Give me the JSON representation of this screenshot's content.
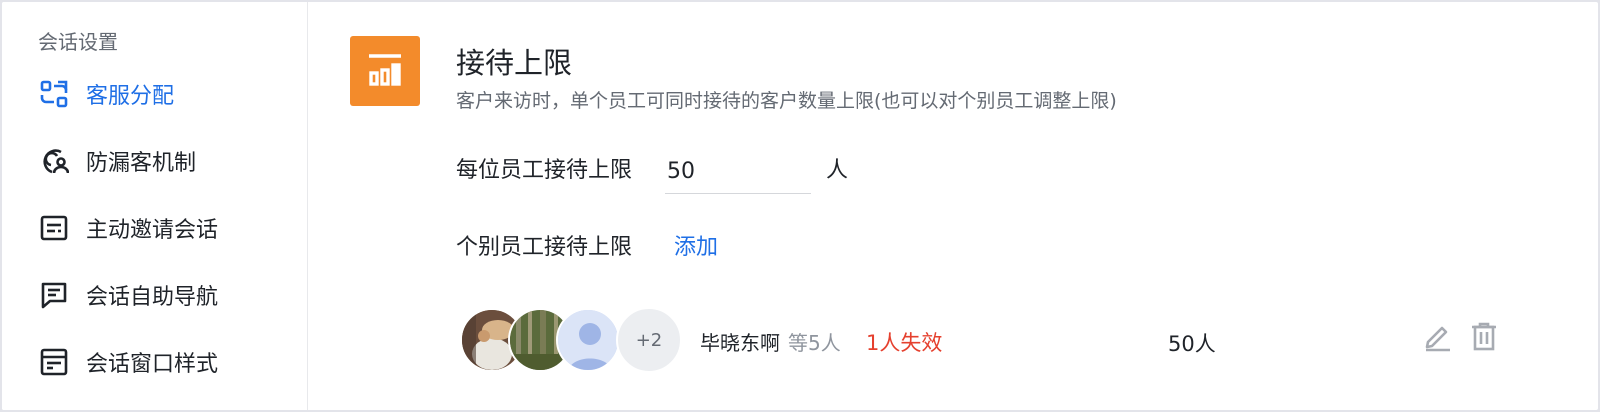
{
  "sidebar": {
    "title": "会话设置",
    "items": [
      {
        "label": "客服分配",
        "icon": "assign-icon",
        "active": true
      },
      {
        "label": "防漏客机制",
        "icon": "anti-leak-icon",
        "active": false
      },
      {
        "label": "主动邀请会话",
        "icon": "invite-icon",
        "active": false
      },
      {
        "label": "会话自助导航",
        "icon": "navigation-icon",
        "active": false
      },
      {
        "label": "会话窗口样式",
        "icon": "window-style-icon",
        "active": false
      }
    ]
  },
  "main": {
    "feature_icon": "bar-chart-icon",
    "title": "接待上限",
    "description": "客户来访时，单个员工可同时接待的客户数量上限(也可以对个别员工调整上限)",
    "per_staff": {
      "label": "每位员工接待上限",
      "value": "50",
      "unit": "人"
    },
    "individual": {
      "label": "个别员工接待上限",
      "add_label": "添加"
    },
    "staff_row": {
      "more_badge": "+2",
      "name": "毕晓东啊",
      "count_text": "等5人",
      "invalid_text": "1人失效",
      "limit": "50人",
      "edit_icon": "edit-icon",
      "delete_icon": "trash-icon"
    }
  },
  "colors": {
    "accent": "#1f6fe6",
    "feature_icon_bg": "#f38b2b",
    "invalid": "#e5402e",
    "muted": "#8f959e"
  }
}
